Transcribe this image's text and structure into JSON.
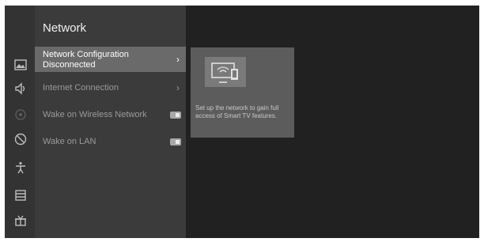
{
  "page": {
    "title": "Network"
  },
  "sidebar_icons": [
    "picture-icon",
    "sound-icon",
    "network-icon",
    "app-icon",
    "accessibility-icon",
    "list-icon",
    "gift-icon"
  ],
  "menu": {
    "items": [
      {
        "label": "Network Configuration",
        "sub": "Disconnected",
        "control": "chevron",
        "selected": true
      },
      {
        "label": "Internet Connection",
        "control": "chevron",
        "selected": false
      },
      {
        "label": "Wake on Wireless Network",
        "control": "toggle",
        "state": "on",
        "selected": false
      },
      {
        "label": "Wake on LAN",
        "control": "toggle",
        "state": "on",
        "selected": false
      }
    ],
    "chevron": "›"
  },
  "info_card": {
    "icon": "tv-network-icon",
    "text": "Set up the network to gain full access of Smart TV features."
  }
}
